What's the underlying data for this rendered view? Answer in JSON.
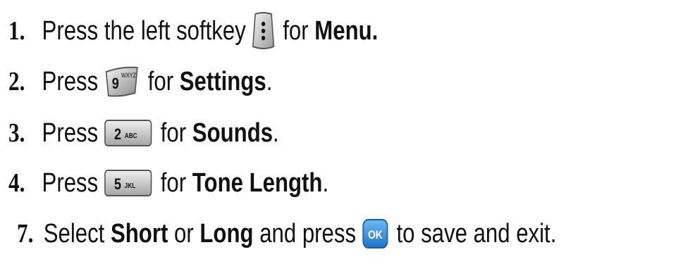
{
  "steps": [
    {
      "number": "1.",
      "pre": "Press the left softkey",
      "key_icon": "left-softkey-icon",
      "mid": "for",
      "bold": "Menu.",
      "post": ""
    },
    {
      "number": "2.",
      "pre": "Press",
      "key_icon": "key-9-wxyz-icon",
      "key_digit": "9",
      "key_letters": "WXYZ",
      "mid": "for",
      "bold": "Settings",
      "post": "."
    },
    {
      "number": "3.",
      "pre": "Press",
      "key_icon": "key-2-abc-icon",
      "key_digit": "2",
      "key_letters": "ABC",
      "mid": "for",
      "bold": "Sounds",
      "post": "."
    },
    {
      "number": "4.",
      "pre": "Press",
      "key_icon": "key-5-jkl-icon",
      "key_digit": "5",
      "key_letters": "JKL",
      "mid": "for",
      "bold": "Tone Length",
      "post": "."
    },
    {
      "number": "7.",
      "pre": "Select",
      "bold_a": "Short",
      "or": "or",
      "bold_b": "Long",
      "and_press": "and press",
      "key_icon": "ok-key-icon",
      "key_label": "OK",
      "post": "to save and exit."
    }
  ],
  "colors": {
    "text": "#111111",
    "ok_key": "#2f8fe0",
    "key_face": "#d8d8d8"
  }
}
